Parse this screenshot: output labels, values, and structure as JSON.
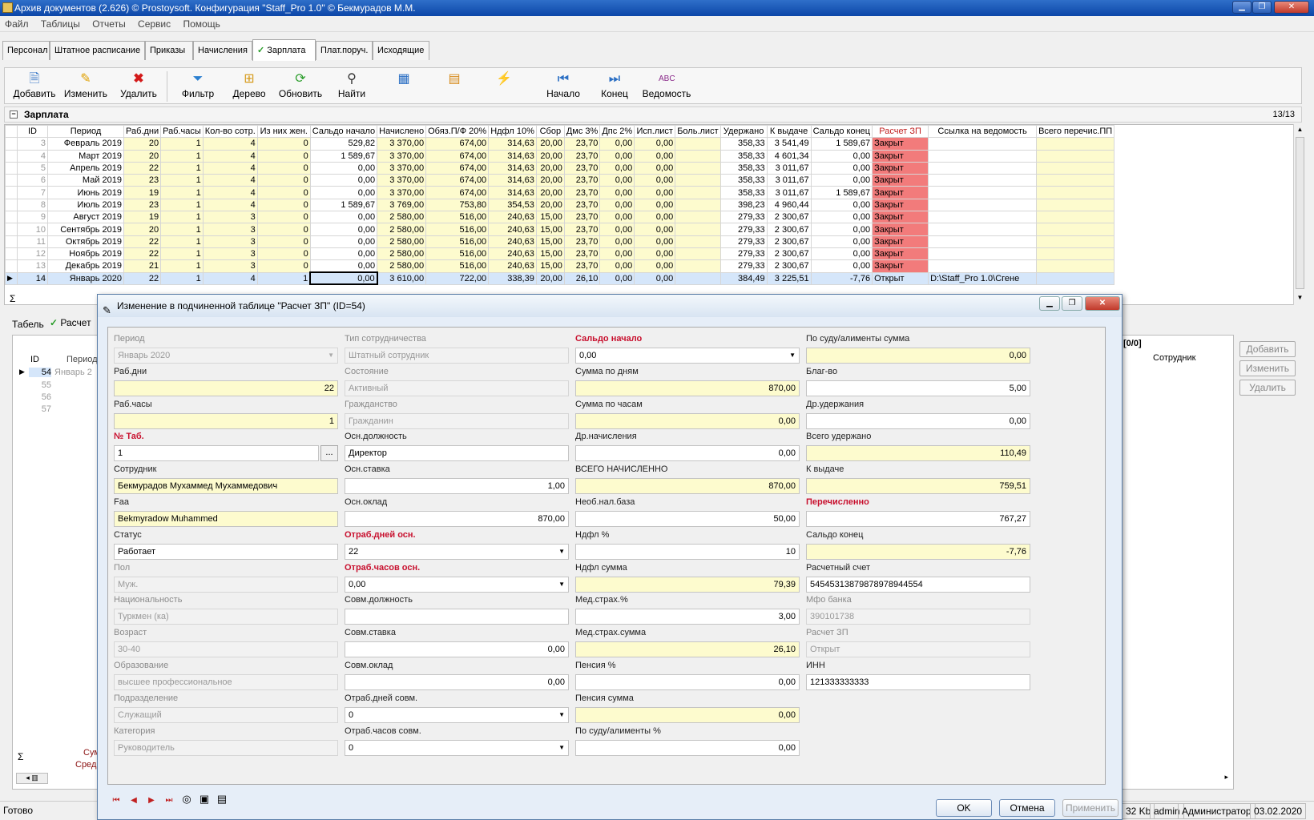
{
  "window": {
    "title": "Архив документов (2.626) © Prostoysoft. Конфигурация \"Staff_Pro 1.0\" © Бекмурадов М.М."
  },
  "menu": [
    "Файл",
    "Таблицы",
    "Отчеты",
    "Сервис",
    "Помощь"
  ],
  "tabs": [
    "Персонал",
    "Штатное расписание",
    "Приказы",
    "Начисления",
    "Зарплата",
    "Плат.поруч.",
    "Исходящие"
  ],
  "toolbar": {
    "add": "Добавить",
    "edit": "Изменить",
    "delete": "Удалить",
    "filter": "Фильтр",
    "tree": "Дерево",
    "refresh": "Обновить",
    "find": "Найти",
    "first": "Начало",
    "last": "Конец",
    "sheet": "Ведомость"
  },
  "grid": {
    "title": "Зарплата",
    "count": "13/13",
    "columns": [
      "ID",
      "Период",
      "Раб.дни",
      "Раб.часы",
      "Кол-во сотр.",
      "Из них жен.",
      "Сальдо начало",
      "Начислено",
      "Обяз.П/Ф 20%",
      "Ндфл 10%",
      "Сбор",
      "Дмс 3%",
      "Дпс 2%",
      "Исп.лист",
      "Боль.лист",
      "Удержано",
      "К выдаче",
      "Сальдо конец",
      "Расчет ЗП",
      "Ссылка на ведомость",
      "Всего перечис.ПП"
    ],
    "rows": [
      [
        "3",
        "Февраль 2019",
        "20",
        "1",
        "4",
        "0",
        "529,82",
        "3 370,00",
        "674,00",
        "314,63",
        "20,00",
        "23,70",
        "0,00",
        "0,00",
        "",
        "358,33",
        "3 541,49",
        "1 589,67",
        "Закрыт",
        "",
        ""
      ],
      [
        "4",
        "Март 2019",
        "20",
        "1",
        "4",
        "0",
        "1 589,67",
        "3 370,00",
        "674,00",
        "314,63",
        "20,00",
        "23,70",
        "0,00",
        "0,00",
        "",
        "358,33",
        "4 601,34",
        "0,00",
        "Закрыт",
        "",
        ""
      ],
      [
        "5",
        "Апрель 2019",
        "22",
        "1",
        "4",
        "0",
        "0,00",
        "3 370,00",
        "674,00",
        "314,63",
        "20,00",
        "23,70",
        "0,00",
        "0,00",
        "",
        "358,33",
        "3 011,67",
        "0,00",
        "Закрыт",
        "",
        ""
      ],
      [
        "6",
        "Май 2019",
        "23",
        "1",
        "4",
        "0",
        "0,00",
        "3 370,00",
        "674,00",
        "314,63",
        "20,00",
        "23,70",
        "0,00",
        "0,00",
        "",
        "358,33",
        "3 011,67",
        "0,00",
        "Закрыт",
        "",
        ""
      ],
      [
        "7",
        "Июнь 2019",
        "19",
        "1",
        "4",
        "0",
        "0,00",
        "3 370,00",
        "674,00",
        "314,63",
        "20,00",
        "23,70",
        "0,00",
        "0,00",
        "",
        "358,33",
        "3 011,67",
        "1 589,67",
        "Закрыт",
        "",
        ""
      ],
      [
        "8",
        "Июль 2019",
        "23",
        "1",
        "4",
        "0",
        "1 589,67",
        "3 769,00",
        "753,80",
        "354,53",
        "20,00",
        "23,70",
        "0,00",
        "0,00",
        "",
        "398,23",
        "4 960,44",
        "0,00",
        "Закрыт",
        "",
        ""
      ],
      [
        "9",
        "Август 2019",
        "19",
        "1",
        "3",
        "0",
        "0,00",
        "2 580,00",
        "516,00",
        "240,63",
        "15,00",
        "23,70",
        "0,00",
        "0,00",
        "",
        "279,33",
        "2 300,67",
        "0,00",
        "Закрыт",
        "",
        ""
      ],
      [
        "10",
        "Сентябрь 2019",
        "20",
        "1",
        "3",
        "0",
        "0,00",
        "2 580,00",
        "516,00",
        "240,63",
        "15,00",
        "23,70",
        "0,00",
        "0,00",
        "",
        "279,33",
        "2 300,67",
        "0,00",
        "Закрыт",
        "",
        ""
      ],
      [
        "11",
        "Октябрь 2019",
        "22",
        "1",
        "3",
        "0",
        "0,00",
        "2 580,00",
        "516,00",
        "240,63",
        "15,00",
        "23,70",
        "0,00",
        "0,00",
        "",
        "279,33",
        "2 300,67",
        "0,00",
        "Закрыт",
        "",
        ""
      ],
      [
        "12",
        "Ноябрь 2019",
        "22",
        "1",
        "3",
        "0",
        "0,00",
        "2 580,00",
        "516,00",
        "240,63",
        "15,00",
        "23,70",
        "0,00",
        "0,00",
        "",
        "279,33",
        "2 300,67",
        "0,00",
        "Закрыт",
        "",
        ""
      ],
      [
        "13",
        "Декабрь 2019",
        "21",
        "1",
        "3",
        "0",
        "0,00",
        "2 580,00",
        "516,00",
        "240,63",
        "15,00",
        "23,70",
        "0,00",
        "0,00",
        "",
        "279,33",
        "2 300,67",
        "0,00",
        "Закрыт",
        "",
        ""
      ],
      [
        "14",
        "Январь 2020",
        "22",
        "1",
        "4",
        "1",
        "0,00",
        "3 610,00",
        "722,00",
        "338,39",
        "20,00",
        "26,10",
        "0,00",
        "0,00",
        "",
        "384,49",
        "3 225,51",
        "-7,76",
        "Открыт",
        "D:\\Staff_Pro 1.0\\Сгене",
        ""
      ]
    ],
    "sum_symbol": "Σ"
  },
  "bottom": {
    "tab1": "Табель",
    "tab2": "Расчет",
    "left_id_header": "ID",
    "left_period_header": "Период",
    "left_period_first": "Январь 2",
    "left_ids": [
      "54",
      "55",
      "56",
      "57"
    ],
    "sum_label": "Сум",
    "avg_label": "Сред",
    "right_count": "[0/0]",
    "right_col": "Сотрудник",
    "btn_add": "Добавить",
    "btn_edit": "Изменить",
    "btn_delete": "Удалить"
  },
  "status": {
    "ready": "Готово",
    "mem": "32 Kb",
    "user": "admin",
    "role": "Администратор",
    "date": "03.02.2020"
  },
  "dialog": {
    "title": "Изменение в подчиненной таблице \"Расчет ЗП\" (ID=54)",
    "ok": "OK",
    "cancel": "Отмена",
    "apply": "Применить",
    "col1": [
      {
        "label": "Период",
        "value": "Январь  2020",
        "dis": true,
        "combo": true
      },
      {
        "label": "Раб.дни",
        "value": "22",
        "y": true,
        "right": true
      },
      {
        "label": "Раб.часы",
        "value": "1",
        "y": true,
        "right": true
      },
      {
        "label": "№ Таб.",
        "value": "1",
        "req": true,
        "dots": true
      },
      {
        "label": "Сотрудник",
        "value": "Бекмурадов Мухаммед Мухаммедович",
        "y": true
      },
      {
        "label": "Faa",
        "value": "Bekmyradow Muhammed",
        "y": true
      },
      {
        "label": "Статус",
        "value": "Работает"
      },
      {
        "label": "Пол",
        "value": "Муж.",
        "dis": true
      },
      {
        "label": "Национальность",
        "value": "Туркмен (ка)",
        "dis": true
      },
      {
        "label": "Возраст",
        "value": "30-40",
        "dis": true
      },
      {
        "label": "Образование",
        "value": "высшее профессиональное",
        "dis": true
      },
      {
        "label": "Подразделение",
        "value": "Служащий",
        "dis": true
      },
      {
        "label": "Категория",
        "value": "Руководитель",
        "dis": true
      }
    ],
    "col2": [
      {
        "label": "Тип сотрудничества",
        "value": "Штатный сотрудник",
        "dis": true
      },
      {
        "label": "Состояние",
        "value": "Активный",
        "dis": true
      },
      {
        "label": "Гражданство",
        "value": "Гражданин",
        "dis": true
      },
      {
        "label": "Осн.должность",
        "value": "Директор"
      },
      {
        "label": "Осн.ставка",
        "value": "1,00",
        "right": true
      },
      {
        "label": "Осн.оклад",
        "value": "870,00",
        "right": true
      },
      {
        "label": "Отраб.дней осн.",
        "value": "22",
        "req": true,
        "combo": true
      },
      {
        "label": "Отраб.часов осн.",
        "value": "0,00",
        "req": true,
        "combo": true
      },
      {
        "label": "Совм.должность",
        "value": ""
      },
      {
        "label": "Совм.ставка",
        "value": "0,00",
        "right": true
      },
      {
        "label": "Совм.оклад",
        "value": "0,00",
        "right": true
      },
      {
        "label": "Отраб.дней совм.",
        "value": "0",
        "combo": true
      },
      {
        "label": "Отраб.часов совм.",
        "value": "0",
        "combo": true
      }
    ],
    "col3": [
      {
        "label": "Сальдо начало",
        "value": "0,00",
        "req": true,
        "combo": true
      },
      {
        "label": "Сумма по дням",
        "value": "870,00",
        "y": true,
        "right": true
      },
      {
        "label": "Сумма по часам",
        "value": "0,00",
        "y": true,
        "right": true
      },
      {
        "label": "Др.начисления",
        "value": "0,00",
        "right": true
      },
      {
        "label": "ВСЕГО НАЧИСЛЕННО",
        "value": "870,00",
        "y": true,
        "right": true
      },
      {
        "label": "Необ.нал.база",
        "value": "50,00",
        "right": true
      },
      {
        "label": "Ндфл %",
        "value": "10",
        "right": true
      },
      {
        "label": "Ндфл сумма",
        "value": "79,39",
        "y": true,
        "right": true
      },
      {
        "label": "Мед.страх.%",
        "value": "3,00",
        "right": true
      },
      {
        "label": "Мед.страх.сумма",
        "value": "26,10",
        "y": true,
        "right": true
      },
      {
        "label": "Пенсия %",
        "value": "0,00",
        "right": true
      },
      {
        "label": "Пенсия сумма",
        "value": "0,00",
        "y": true,
        "right": true
      },
      {
        "label": "По суду/алименты %",
        "value": "0,00",
        "right": true
      }
    ],
    "col4": [
      {
        "label": "По суду/алименты сумма",
        "value": "0,00",
        "y": true,
        "right": true
      },
      {
        "label": "Благ-во",
        "value": "5,00",
        "right": true
      },
      {
        "label": "Др.удержания",
        "value": "0,00",
        "right": true
      },
      {
        "label": "Всего удержано",
        "value": "110,49",
        "y": true,
        "right": true
      },
      {
        "label": "К выдаче",
        "value": "759,51",
        "y": true,
        "right": true
      },
      {
        "label": "Перечисленно",
        "value": "767,27",
        "req": true,
        "right": true
      },
      {
        "label": "Сальдо конец",
        "value": "-7,76",
        "y": true,
        "right": true
      },
      {
        "label": "Расчетный счет",
        "value": "54545313879878978944554"
      },
      {
        "label": "Мфо банка",
        "value": "390101738",
        "dis": true
      },
      {
        "label": "Расчет ЗП",
        "value": "Открыт",
        "dis": true
      },
      {
        "label": "ИНН",
        "value": "121333333333"
      },
      null,
      null
    ]
  }
}
